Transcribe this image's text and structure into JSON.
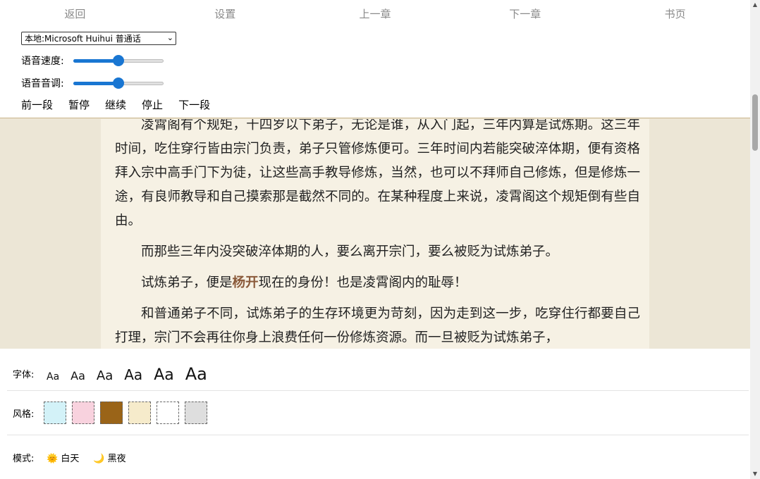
{
  "nav": {
    "back": "返回",
    "settings": "设置",
    "prev_chapter": "上一章",
    "next_chapter": "下一章",
    "bookmark": "书页"
  },
  "tts": {
    "voice_selected": "本地:Microsoft Huihui 普通话",
    "speed_label": "语音速度:",
    "speed_value": 0.5,
    "pitch_label": "语音音调:",
    "pitch_value": 0.5,
    "controls": {
      "prev_paragraph": "前一段",
      "pause": "暂停",
      "resume": "继续",
      "stop": "停止",
      "next_paragraph": "下一段"
    }
  },
  "content": {
    "p1": "凌霄阁有个规矩，十四岁以下弟子，无论是谁，从入门起，三年内算是试炼期。这三年时间，吃住穿行皆由宗门负责，弟子只管修炼便可。三年时间内若能突破淬体期，便有资格拜入宗中高手门下为徒，让这些高手教导修炼，当然，也可以不拜师自己修炼，但是修炼一途，有良师教导和自己摸索那是截然不同的。在某种程度上来说，凌霄阁这个规矩倒有些自由。",
    "p2": "而那些三年内没突破淬体期的人，要么离开宗门，要么被贬为试炼弟子。",
    "p3_before": "试炼弟子，便是",
    "p3_name": "杨开",
    "p3_after": "现在的身份！也是凌霄阁内的耻辱！",
    "p4": "和普通弟子不同，试炼弟子的生存环境更为苛刻，因为走到这一步，吃穿住行都要自己打理，宗门不会再往你身上浪费任何一份修炼资源。而一旦被贬为试炼弟子，"
  },
  "settings": {
    "font_label": "字体:",
    "font_sample": "Aa",
    "style_label": "风格:",
    "styles": [
      "#d3f2f8",
      "#f8d2de",
      "#9a6418",
      "#f6ebcb",
      "#ffffff",
      "#dedede"
    ],
    "mode_label": "模式:",
    "day_mode": "🌞 白天",
    "night_mode": "🌙 黑夜"
  },
  "colors": {
    "accent": "#1976d2",
    "page_bg": "#f6f1e4",
    "highlight_name": "#8a5a3a"
  }
}
